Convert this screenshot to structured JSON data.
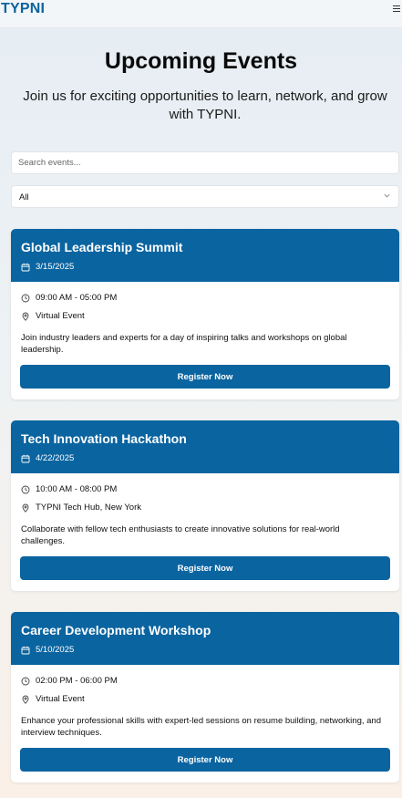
{
  "header": {
    "logo": "TYPNI",
    "menu_icon": "hamburger-menu-icon"
  },
  "hero": {
    "title": "Upcoming Events",
    "subtitle": "Join us for exciting opportunities to learn, network, and grow with TYPNI."
  },
  "filters": {
    "search_placeholder": "Search events...",
    "search_value": "",
    "category_selected": "All"
  },
  "events": [
    {
      "title": "Global Leadership Summit",
      "date": "3/15/2025",
      "time": "09:00 AM - 05:00 PM",
      "location": "Virtual Event",
      "description": "Join industry leaders and experts for a day of inspiring talks and workshops on global leadership.",
      "button": "Register Now"
    },
    {
      "title": "Tech Innovation Hackathon",
      "date": "4/22/2025",
      "time": "10:00 AM - 08:00 PM",
      "location": "TYPNI Tech Hub, New York",
      "description": "Collaborate with fellow tech enthusiasts to create innovative solutions for real-world challenges.",
      "button": "Register Now"
    },
    {
      "title": "Career Development Workshop",
      "date": "5/10/2025",
      "time": "02:00 PM - 06:00 PM",
      "location": "Virtual Event",
      "description": "Enhance your professional skills with expert-led sessions on resume building, networking, and interview techniques.",
      "button": "Register Now"
    }
  ],
  "colors": {
    "brand": "#0a64a0",
    "logo": "#0b639d"
  }
}
